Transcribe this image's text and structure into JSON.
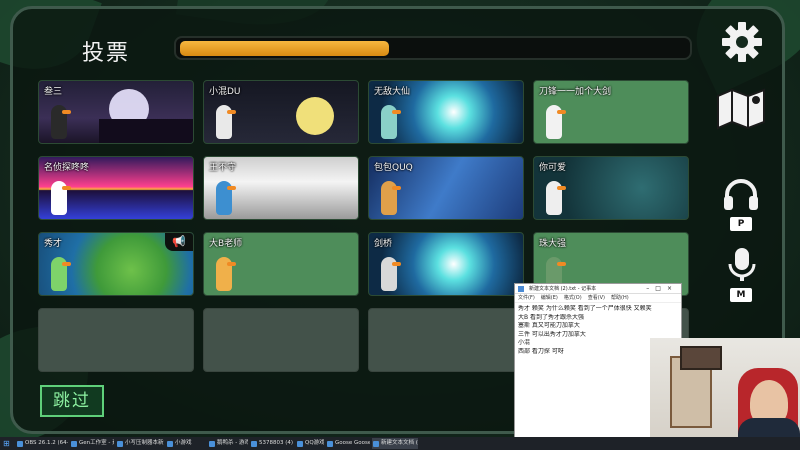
{
  "screen": {
    "title": "投票",
    "vote_timer_fraction": 0.41,
    "skip_label": "跳过"
  },
  "players": [
    {
      "name": "叁三",
      "theme": "night-castle",
      "bird_color": "#2a2a2a"
    },
    {
      "name": "小混DU",
      "theme": "moon",
      "bird_color": "#e9e9e9"
    },
    {
      "name": "无敌大仙",
      "theme": "warp",
      "bird_color": "#8ad0c8"
    },
    {
      "name": "刀锋一一加个大剑",
      "theme": "plain",
      "bird_color": "#f2f2f2"
    },
    {
      "name": "名侦探咚咚",
      "theme": "synthwave",
      "bird_color": "#ffffff"
    },
    {
      "name": "王不守",
      "theme": "mist",
      "bird_color": "#3d8fd0"
    },
    {
      "name": "包包QUQ",
      "theme": "feathers",
      "bird_color": "#e0a04a"
    },
    {
      "name": "你可爱",
      "theme": "bubbles",
      "bird_color": "#eeeeee"
    },
    {
      "name": "秀才",
      "theme": "lily",
      "bird_color": "#7ed36a",
      "megaphone": true
    },
    {
      "name": "大B老师",
      "theme": "plain",
      "bird_color": "#f0b04a"
    },
    {
      "name": "剑桥",
      "theme": "warp",
      "bird_color": "#d8d8d8"
    },
    {
      "name": "珠大强",
      "theme": "plain",
      "bird_color": "#6a9a6a"
    }
  ],
  "empty_slots": 4,
  "side_controls": [
    {
      "name": "settings",
      "icon": "gear-icon"
    },
    {
      "name": "map",
      "icon": "map-icon"
    },
    {
      "name": "push-to-talk",
      "icon": "headphones-icon",
      "key": "P"
    },
    {
      "name": "mic",
      "icon": "microphone-icon",
      "key": "M"
    }
  ],
  "notepad": {
    "title": "新建文本文档 (2).txt - 记事本",
    "menu": [
      "文件(F)",
      "编辑(E)",
      "格式(O)",
      "查看(V)",
      "帮助(H)"
    ],
    "lines": [
      "秀才 赖笑 为什么赖笑 看到了一个尸体很快 又赖笑",
      "大B 看到了秀才跟杀大强",
      "塞斯 真又可能刀加拿大",
      "三件 可以出秀才刀加拿大",
      "小混",
      "西部 看刀探 可呀"
    ]
  },
  "taskbar": [
    {
      "label": "OBS 26.1.2 (64-bit..."
    },
    {
      "label": "Gen工作室 - 素材..."
    },
    {
      "label": "小写压制器本新文..."
    },
    {
      "label": "小游戏"
    },
    {
      "label": "鹅鸭杀 - 游戏"
    },
    {
      "label": "5378803 (4)"
    },
    {
      "label": "QQ游戏"
    },
    {
      "label": "Goose Goose Du..."
    },
    {
      "label": "新建文本文档 (2).t..."
    }
  ],
  "colors": {
    "timer": "#f2a92c",
    "skip": "#5fd07a",
    "card": "#4e8d5a",
    "empty_card": "#43524a"
  }
}
